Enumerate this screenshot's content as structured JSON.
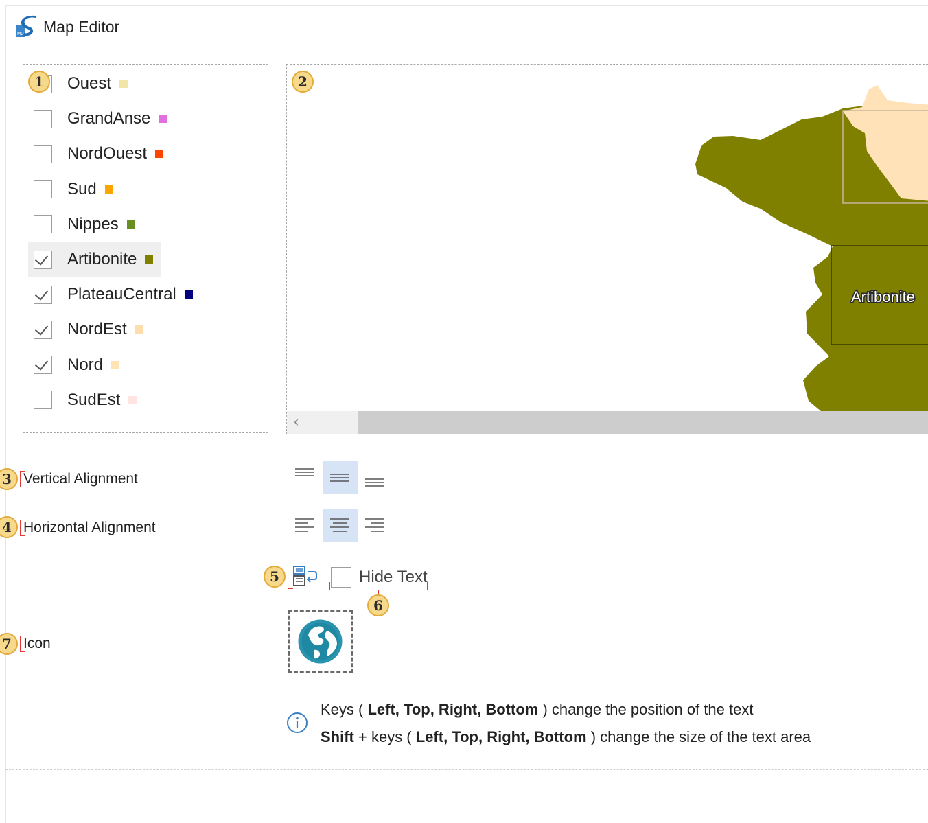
{
  "window": {
    "title": "Map Editor"
  },
  "regions": [
    {
      "label": "Ouest",
      "checked": false,
      "color": "#f0e6a8"
    },
    {
      "label": "GrandAnse",
      "checked": false,
      "color": "#e070e0"
    },
    {
      "label": "NordOuest",
      "checked": false,
      "color": "#ff4500"
    },
    {
      "label": "Sud",
      "checked": false,
      "color": "#ffa500"
    },
    {
      "label": "Nippes",
      "checked": false,
      "color": "#6b8e23"
    },
    {
      "label": "Artibonite",
      "checked": true,
      "color": "#808000",
      "selected": true
    },
    {
      "label": "PlateauCentral",
      "checked": true,
      "color": "#000080"
    },
    {
      "label": "NordEst",
      "checked": true,
      "color": "#ffdead"
    },
    {
      "label": "Nord",
      "checked": true,
      "color": "#ffe4b5"
    },
    {
      "label": "SudEst",
      "checked": false,
      "color": "#ffe4e1"
    }
  ],
  "map": {
    "selected_region_label": "Artibonite",
    "colors": {
      "artibonite": "#808000",
      "nord": "#ffe2b8"
    }
  },
  "badges": {
    "b1": "1",
    "b2": "2",
    "b3": "3",
    "b4": "4",
    "b5": "5",
    "b6": "6",
    "b7": "7"
  },
  "vertical_alignment": {
    "label": "Vertical Alignment",
    "options": [
      "top-align-icon",
      "middle-align-icon",
      "bottom-align-icon"
    ],
    "active_index": 1
  },
  "horizontal_alignment": {
    "label": "Horizontal Alignment",
    "options": [
      "align-left-icon",
      "align-center-icon",
      "align-right-icon"
    ],
    "active_index": 1
  },
  "hide_text": {
    "label": "Hide Text",
    "checked": false
  },
  "icon_field": {
    "label": "Icon",
    "icon": "globe-icon"
  },
  "info": {
    "line1": {
      "pre": "Keys ( ",
      "keys": "Left, Top, Right, Bottom",
      "post": " ) change the position of the text"
    },
    "line2": {
      "shift": "Shift",
      "mid": " + keys ( ",
      "keys": "Left, Top, Right, Bottom",
      "post": " ) change the size of the text area"
    }
  }
}
